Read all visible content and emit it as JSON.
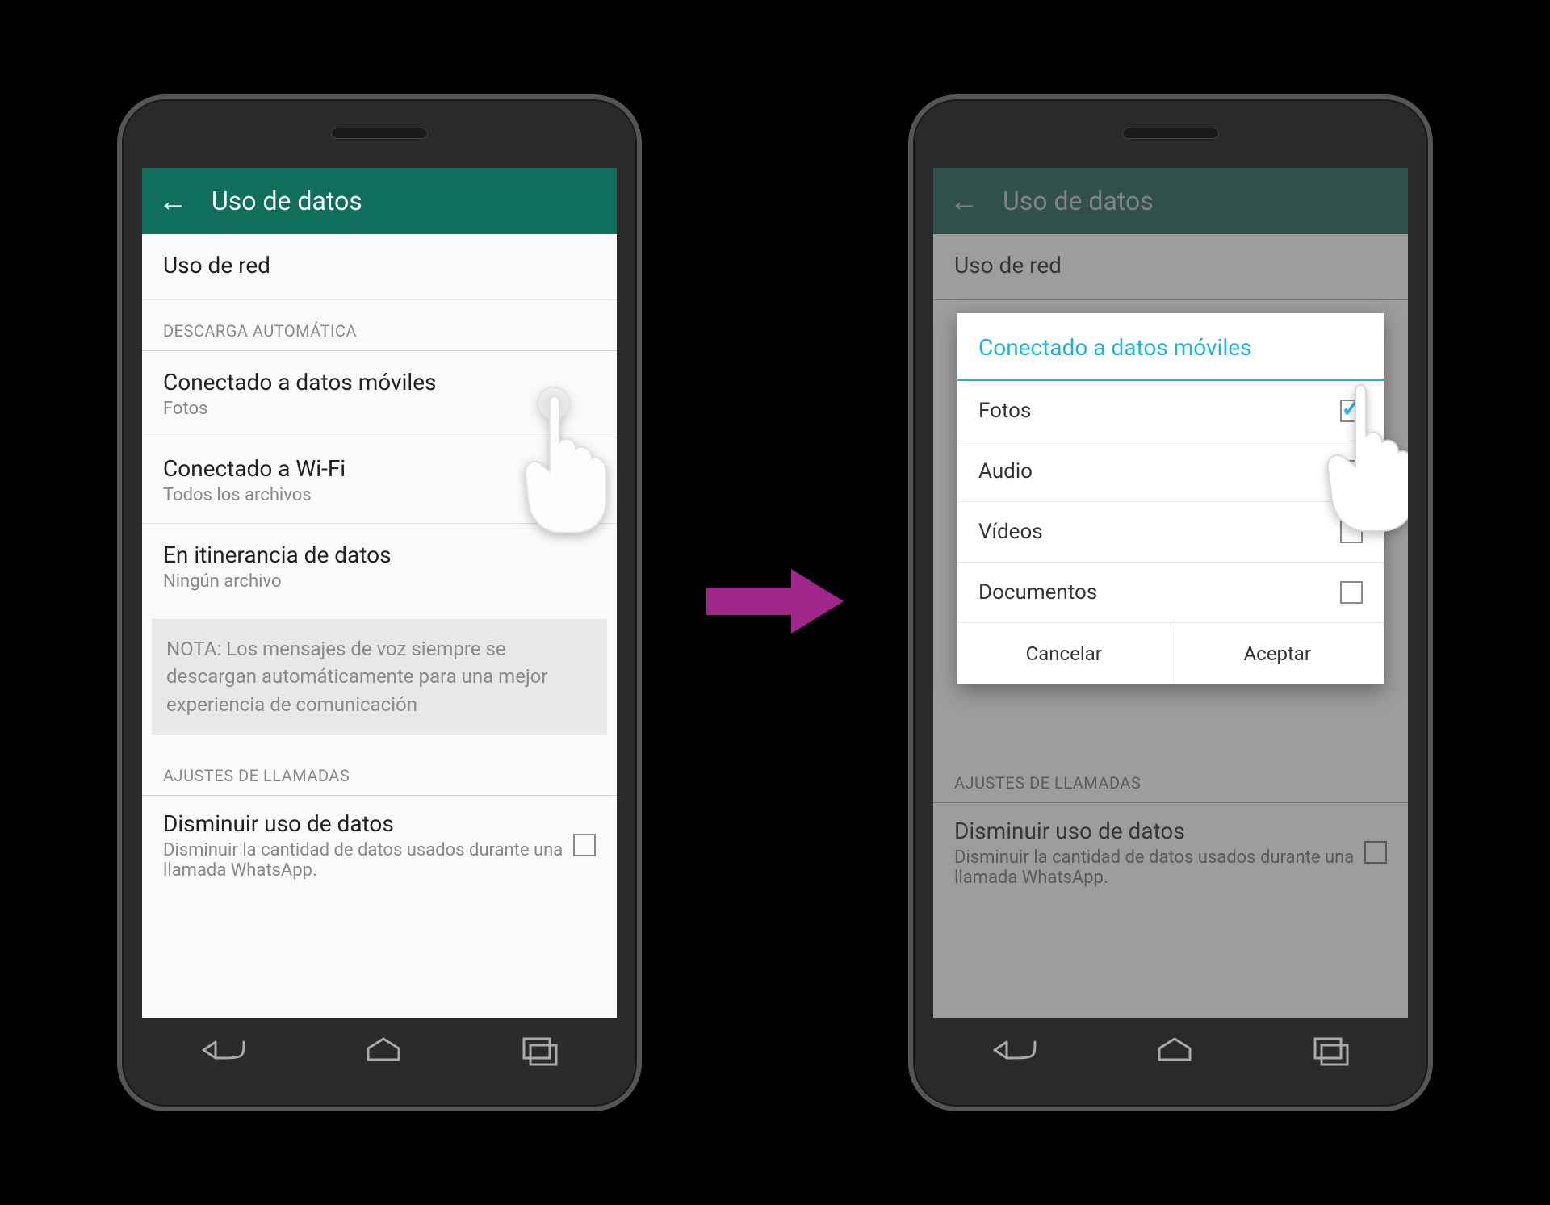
{
  "phone1": {
    "appBar": {
      "title": "Uso de datos"
    },
    "section1": {
      "title": "Uso de red"
    },
    "sectionHeader1": "DESCARGA AUTOMÁTICA",
    "items": [
      {
        "title": "Conectado a datos móviles",
        "sub": "Fotos"
      },
      {
        "title": "Conectado a Wi-Fi",
        "sub": "Todos los archivos"
      },
      {
        "title": "En itinerancia de datos",
        "sub": "Ningún archivo"
      }
    ],
    "note": "NOTA: Los mensajes de voz siempre se descargan automáticamente para una mejor experiencia de comunicación",
    "sectionHeader2": "AJUSTES DE LLAMADAS",
    "callItem": {
      "title": "Disminuir uso de datos",
      "sub": "Disminuir la cantidad de datos usados durante una llamada WhatsApp."
    }
  },
  "phone2": {
    "appBar": {
      "title": "Uso de datos"
    },
    "section1": {
      "title": "Uso de red"
    },
    "sectionHeader2": "AJUSTES DE LLAMADAS",
    "callItem": {
      "title": "Disminuir uso de datos",
      "sub": "Disminuir la cantidad de datos usados durante una llamada WhatsApp."
    },
    "dialog": {
      "title": "Conectado a datos móviles",
      "options": [
        {
          "label": "Fotos",
          "checked": true
        },
        {
          "label": "Audio",
          "checked": false
        },
        {
          "label": "Vídeos",
          "checked": false
        },
        {
          "label": "Documentos",
          "checked": false
        }
      ],
      "cancel": "Cancelar",
      "accept": "Aceptar"
    }
  }
}
